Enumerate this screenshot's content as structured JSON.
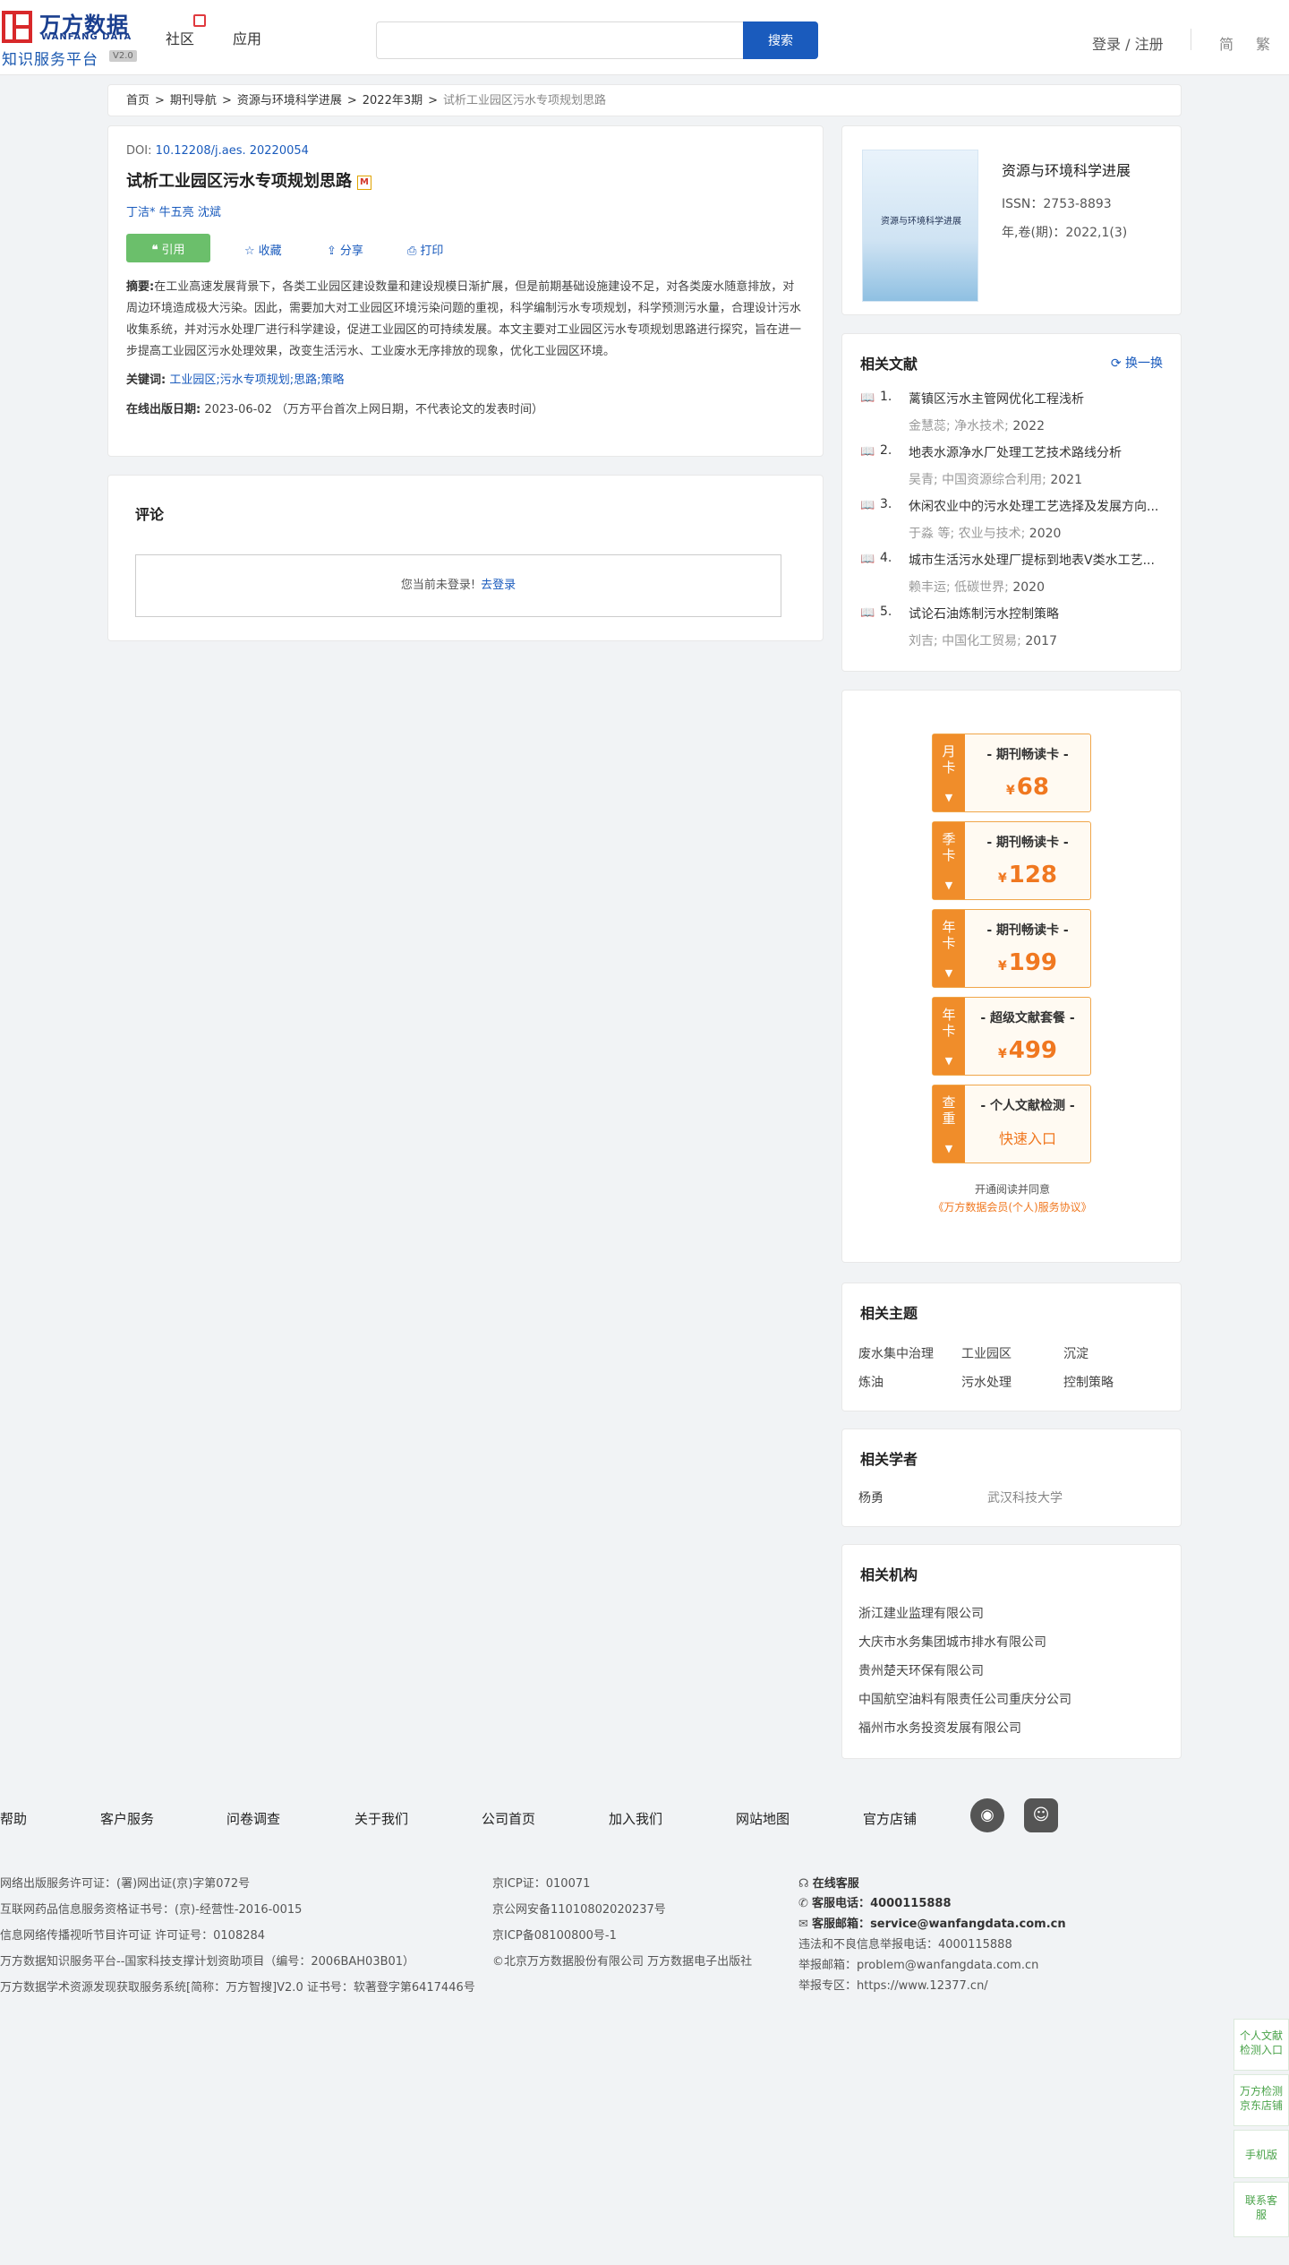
{
  "header": {
    "brand": "万方数据",
    "brand_en": "WANFANG DATA",
    "platform": "知识服务平台",
    "version": "V2.0",
    "nav": [
      "社区",
      "应用"
    ],
    "search_placeholder": "",
    "search_button": "搜索",
    "login": "登录 / 注册",
    "lang_simplified": "简",
    "lang_traditional": "繁"
  },
  "breadcrumb": [
    "首页",
    "期刊导航",
    "资源与环境科学进展",
    "2022年3期",
    "试析工业园区污水专项规划思路"
  ],
  "article": {
    "doi_label": "DOI: ",
    "doi": "10.12208/j.aes. 20220054",
    "title": "试析工业园区污水专项规划思路",
    "title_badge": "M",
    "authors": [
      "丁洁*",
      "牛五亮",
      "沈斌"
    ],
    "actions": {
      "cite": "引用",
      "collect": "收藏",
      "share": "分享",
      "print": "打印"
    },
    "abstract_label": "摘要:",
    "abstract": "在工业高速发展背景下，各类工业园区建设数量和建设规模日渐扩展，但是前期基础设施建设不足，对各类废水随意排放，对周边环境造成极大污染。因此，需要加大对工业园区环境污染问题的重视，科学编制污水专项规划，科学预测污水量，合理设计污水收集系统，并对污水处理厂进行科学建设，促进工业园区的可持续发展。本文主要对工业园区污水专项规划思路进行探究，旨在进一步提高工业园区污水处理效果，改变生活污水、工业废水无序排放的现象，优化工业园区环境。",
    "keywords_label": "关键词:",
    "keywords": [
      "工业园区;",
      "污水专项规划;",
      "思路;",
      "策略"
    ],
    "pubdate_label": "在线出版日期:",
    "pubdate": "2023-06-02 （万方平台首次上网日期，不代表论文的发表时间）"
  },
  "comments": {
    "title": "评论",
    "not_logged_in": "您当前未登录!",
    "login_link": "去登录"
  },
  "journal": {
    "cover_title": "资源与环境科学进展",
    "name": "资源与环境科学进展",
    "issn": "ISSN：2753-8893",
    "year_issue": "年,卷(期)：2022,1(3)"
  },
  "related_docs": {
    "title": "相关文献",
    "refresh": "换一换",
    "items": [
      {
        "num": "1.",
        "title": "蓠镇区污水主管网优化工程浅析",
        "authors": "金慧蕊",
        "source": "净水技术",
        "year": "2022"
      },
      {
        "num": "2.",
        "title": "地表水源净水厂处理工艺技术路线分析",
        "authors": "吴青",
        "source": "中国资源综合利用",
        "year": "2021"
      },
      {
        "num": "3.",
        "title": "休闲农业中的污水处理工艺选择及发展方向...",
        "authors": "于淼  等",
        "source": "农业与技术",
        "year": "2020"
      },
      {
        "num": "4.",
        "title": "城市生活污水处理厂提标到地表Ⅴ类水工艺...",
        "authors": "赖丰运",
        "source": "低碳世界",
        "year": "2020"
      },
      {
        "num": "5.",
        "title": "试论石油炼制污水控制策略",
        "authors": "刘吉",
        "source": "中国化工贸易",
        "year": "2017"
      }
    ]
  },
  "packages": {
    "currency": "¥",
    "items": [
      {
        "side": [
          "月",
          "卡"
        ],
        "name": "- 期刊畅读卡 -",
        "price": "68"
      },
      {
        "side": [
          "季",
          "卡"
        ],
        "name": "- 期刊畅读卡 -",
        "price": "128"
      },
      {
        "side": [
          "年",
          "卡"
        ],
        "name": "- 期刊畅读卡 -",
        "price": "199"
      },
      {
        "side": [
          "年",
          "卡"
        ],
        "name": "- 超级文献套餐 -",
        "price": "499"
      },
      {
        "side": [
          "查",
          "重"
        ],
        "name": "- 个人文献检测 -",
        "entry": "快速入口"
      }
    ],
    "agree_text": "开通阅读并同意",
    "agree_link": "《万方数据会员(个人)服务协议》"
  },
  "topics": {
    "title": "相关主题",
    "items": [
      "废水集中治理",
      "工业园区",
      "沉淀",
      "炼油",
      "污水处理",
      "控制策略"
    ]
  },
  "scholars": {
    "title": "相关学者",
    "items": [
      {
        "name": "杨勇",
        "org": "武汉科技大学"
      }
    ]
  },
  "institutions": {
    "title": "相关机构",
    "items": [
      "浙江建业监理有限公司",
      "大庆市水务集团城市排水有限公司",
      "贵州楚天环保有限公司",
      "中国航空油料有限责任公司重庆分公司",
      "福州市水务投资发展有限公司"
    ]
  },
  "footer": {
    "nav": [
      "帮助",
      "客户服务",
      "问卷调查",
      "关于我们",
      "公司首页",
      "加入我们",
      "网站地图",
      "官方店铺"
    ],
    "col1": [
      "网络出版服务许可证：(署)网出证(京)字第072号",
      "互联网药品信息服务资格证书号：(京)-经营性-2016-0015",
      "信息网络传播视听节目许可证 许可证号：0108284",
      "万方数据知识服务平台--国家科技支撑计划资助项目（编号：2006BAH03B01）",
      "万方数据学术资源发现获取服务系统[简称：万方智搜]V2.0 证书号：软著登字第6417446号"
    ],
    "col2": [
      "京ICP证：010071",
      "京公网安备11010802020237号",
      "京ICP备08100800号-1",
      "©北京万方数据股份有限公司 万方数据电子出版社"
    ],
    "service_label": "在线客服",
    "phone_label": "客服电话：",
    "phone": "4000115888",
    "email_label": "客服邮箱：",
    "email": "service@wanfangdata.com.cn",
    "report_phone": "违法和不良信息举报电话：4000115888",
    "report_email": "举报邮箱：problem@wanfangdata.com.cn",
    "report_site": "举报专区：https://www.12377.cn/"
  },
  "float_panel": [
    "个人文献检测入口",
    "万方检测京东店铺",
    "手机版",
    "联系客服"
  ]
}
